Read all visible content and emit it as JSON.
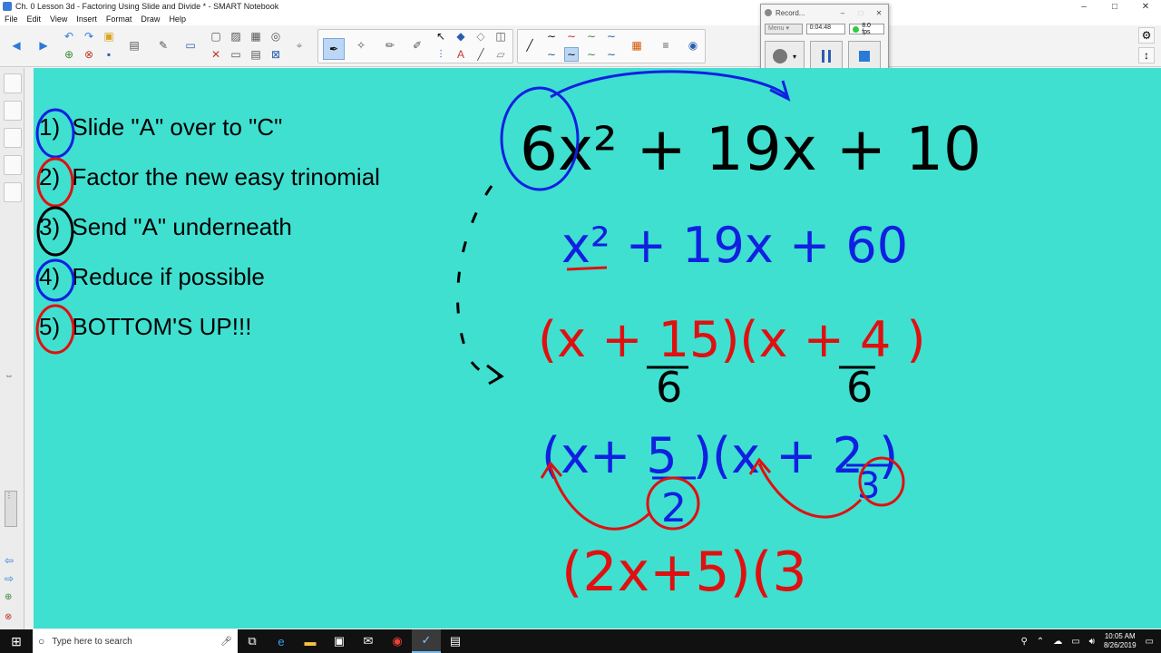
{
  "window": {
    "title": "Ch. 0 Lesson 3d - Factoring Using Slide and Divide * - SMART Notebook",
    "controls": [
      "–",
      "□",
      "✕"
    ]
  },
  "menubar": {
    "items": [
      "File",
      "Edit",
      "View",
      "Insert",
      "Format",
      "Draw",
      "Help"
    ]
  },
  "recorder": {
    "title": "Record...",
    "menu_label": "Menu",
    "elapsed": "0:04:48",
    "fps": "8.0 fps",
    "status_color": "#2ecc40"
  },
  "lesson": {
    "steps": [
      {
        "number": "1)",
        "text": "Slide \"A\" over to \"C\"",
        "circle_color": "#1020e0"
      },
      {
        "number": "2)",
        "text": "Factor the new easy trinomial",
        "circle_color": "#e01010"
      },
      {
        "number": "3)",
        "text": "Send \"A\" underneath",
        "circle_color": "#000000"
      },
      {
        "number": "4)",
        "text": "Reduce if possible",
        "circle_color": "#1020e0"
      },
      {
        "number": "5)",
        "text": "BOTTOM'S UP!!!",
        "circle_color": "#e01010"
      }
    ]
  },
  "handwriting": {
    "original": "6x² + 19x + 10",
    "slid": "x² + 19x + 60",
    "factored": "(x + 15/6)(x + 4/6)",
    "reduced": "(x + 5/2)(x + 2/3)",
    "final_partial": "(2x+5)(3",
    "colors": {
      "black": "#000000",
      "blue": "#1020e0",
      "red": "#e01010"
    }
  },
  "taskbar": {
    "search_placeholder": "Type here to search",
    "time": "10:05 AM",
    "date": "8/26/2019"
  },
  "colors": {
    "canvas_bg": "#3fe0d0"
  }
}
